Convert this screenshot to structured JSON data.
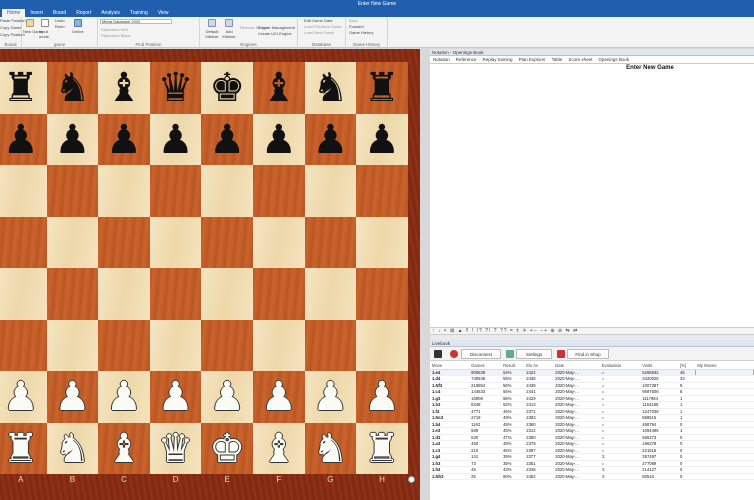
{
  "app": {
    "title": "Enter New Game"
  },
  "ribbon_tabs": [
    "Home",
    "Insert",
    "Board",
    "Report",
    "Analysis",
    "Training",
    "View"
  ],
  "ribbon": {
    "groups": [
      "Board",
      "game",
      "Find Position",
      "Engines",
      "Database",
      "Game History"
    ],
    "clipboard": [
      "Paste Position",
      "Copy Game",
      "Copy Position"
    ],
    "game": [
      "New Game",
      "Input mode",
      "Undo",
      "Redo"
    ],
    "online": "Online",
    "find": {
      "database": "Mega Database 2020",
      "items": [
        "Repertoire Whi",
        "Repertoire Black"
      ]
    },
    "engines": [
      "Add Kibitzer",
      "Default Kibitzer",
      "Remove Kibitzer",
      "Engine Management",
      "Create UCI Engine"
    ],
    "database": [
      "Edit Game Data",
      "Load Previous Game",
      "Load Next Game"
    ],
    "history": [
      "Back",
      "Forward",
      "Game History"
    ]
  },
  "board": {
    "files": [
      "A",
      "B",
      "C",
      "D",
      "E",
      "F",
      "G",
      "H"
    ],
    "ranks": [
      [
        {
          "g": "♜",
          "c": "black"
        },
        {
          "g": "♞",
          "c": "black"
        },
        {
          "g": "♝",
          "c": "black"
        },
        {
          "g": "♛",
          "c": "black"
        },
        {
          "g": "♚",
          "c": "black"
        },
        {
          "g": "♝",
          "c": "black"
        },
        {
          "g": "♞",
          "c": "black"
        },
        {
          "g": "♜",
          "c": "black"
        }
      ],
      [
        {
          "g": "♟",
          "c": "black"
        },
        {
          "g": "♟",
          "c": "black"
        },
        {
          "g": "♟",
          "c": "black"
        },
        {
          "g": "♟",
          "c": "black"
        },
        {
          "g": "♟",
          "c": "black"
        },
        {
          "g": "♟",
          "c": "black"
        },
        {
          "g": "♟",
          "c": "black"
        },
        {
          "g": "♟",
          "c": "black"
        }
      ],
      [
        null,
        null,
        null,
        null,
        null,
        null,
        null,
        null
      ],
      [
        null,
        null,
        null,
        null,
        null,
        null,
        null,
        null
      ],
      [
        null,
        null,
        null,
        null,
        null,
        null,
        null,
        null
      ],
      [
        null,
        null,
        null,
        null,
        null,
        null,
        null,
        null
      ],
      [
        {
          "g": "♟",
          "c": "white"
        },
        {
          "g": "♟",
          "c": "white"
        },
        {
          "g": "♟",
          "c": "white"
        },
        {
          "g": "♟",
          "c": "white"
        },
        {
          "g": "♟",
          "c": "white"
        },
        {
          "g": "♟",
          "c": "white"
        },
        {
          "g": "♟",
          "c": "white"
        },
        {
          "g": "♟",
          "c": "white"
        }
      ],
      [
        {
          "g": "♜",
          "c": "white"
        },
        {
          "g": "♞",
          "c": "white"
        },
        {
          "g": "♝",
          "c": "white"
        },
        {
          "g": "♛",
          "c": "white"
        },
        {
          "g": "♚",
          "c": "white"
        },
        {
          "g": "♝",
          "c": "white"
        },
        {
          "g": "♞",
          "c": "white"
        },
        {
          "g": "♜",
          "c": "white"
        }
      ]
    ]
  },
  "notation": {
    "header": "Notation - Openings Book",
    "tabs": [
      "Notation",
      "Reference",
      "Replay training",
      "Plan Explorer",
      "Table",
      "Score sheet",
      "Openings Book"
    ],
    "title": "Enter New Game",
    "toolbar": "↑ ↓ × ⊠ ▲ ‼ ! !? ?! ? ?? = ± ∓ +− −+ ⊕ ⊘ ⇆ ⇄"
  },
  "livebook": {
    "header": "Livebook",
    "buttons": [
      "Disconnect",
      "Settings",
      "Find in Shop"
    ],
    "columns": [
      "Move",
      "Games",
      "Result",
      "Elo Av",
      "Date",
      "Evaluation",
      "Visits",
      "[%]",
      "My Moves"
    ],
    "rows": [
      [
        "1.e4",
        "900838",
        "54%",
        "2422",
        "2020-May-...",
        "=",
        "5266932",
        "46",
        ""
      ],
      [
        "1.d4",
        "740548",
        "55%",
        "2436",
        "2020-May-...",
        "=",
        "3420025",
        "33",
        ""
      ],
      [
        "1.Nf3",
        "219854",
        "56%",
        "2439",
        "2020-May-...",
        "=",
        "1007387",
        "9",
        ""
      ],
      [
        "1.c4",
        "144533",
        "56%",
        "2441",
        "2020-May-...",
        "=",
        "9597506",
        "8",
        ""
      ],
      [
        "1.g3",
        "16908",
        "56%",
        "2429",
        "2020-May-...",
        "=",
        "1117984",
        "1",
        ""
      ],
      [
        "1.b3",
        "8348",
        "52%",
        "2413",
        "2020-May-...",
        "=",
        "1164185",
        "1",
        ""
      ],
      [
        "1.f4",
        "4771",
        "46%",
        "2371",
        "2020-May-...",
        "=",
        "1247038",
        "1",
        ""
      ],
      [
        "1.Nc3",
        "2719",
        "49%",
        "2383",
        "2020-May-...",
        "=",
        "868515",
        "1",
        ""
      ],
      [
        "1.b4",
        "1162",
        "48%",
        "2360",
        "2020-May-...",
        "=",
        "468794",
        "0",
        ""
      ],
      [
        "1.e3",
        "589",
        "45%",
        "2312",
        "2020-May-...",
        "=",
        "1094495",
        "1",
        ""
      ],
      [
        "1.d3",
        "530",
        "47%",
        "2360",
        "2020-May-...",
        "=",
        "565373",
        "0",
        ""
      ],
      [
        "1.a3",
        "460",
        "48%",
        "2379",
        "2020-May-...",
        "=",
        "186378",
        "0",
        ""
      ],
      [
        "1.c3",
        "210",
        "46%",
        "2397",
        "2020-May-...",
        "=",
        "221616",
        "0",
        ""
      ],
      [
        "1.g4",
        "141",
        "39%",
        "2377",
        "2020-May-...",
        "∓",
        "357497",
        "0",
        ""
      ],
      [
        "1.h3",
        "73",
        "35%",
        "2351",
        "2020-May-...",
        "=",
        "277089",
        "0",
        ""
      ],
      [
        "1.h4",
        "45",
        "43%",
        "2348",
        "2020-May-...",
        "∓",
        "214127",
        "0",
        ""
      ],
      [
        "1.Nh3",
        "25",
        "60%",
        "2452",
        "2020-May-...",
        "∓",
        "80516",
        "0",
        ""
      ]
    ]
  },
  "colors": {
    "titlebar": "#1f5fae",
    "light_square": "#f1dcae",
    "dark_square": "#c35d28",
    "frame": "#8a2c10"
  }
}
